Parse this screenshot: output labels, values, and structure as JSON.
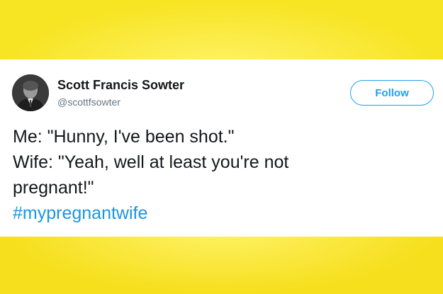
{
  "tweet": {
    "author": {
      "display_name": "Scott Francis Sowter",
      "handle": "@scottfsowter"
    },
    "follow_label": "Follow",
    "lines": [
      "Me: \"Hunny, I've been shot.\"",
      "Wife: \"Yeah, well at least you're not",
      "pregnant!\""
    ],
    "hashtag": "#mypregnantwife"
  },
  "colors": {
    "background_yellow": "#f7e326",
    "card": "#ffffff",
    "accent_blue": "#1da1f2",
    "hashtag_blue": "#1b95e0",
    "text_dark": "#14171a",
    "text_muted": "#657786"
  },
  "icons": {
    "avatar": "profile-photo"
  }
}
